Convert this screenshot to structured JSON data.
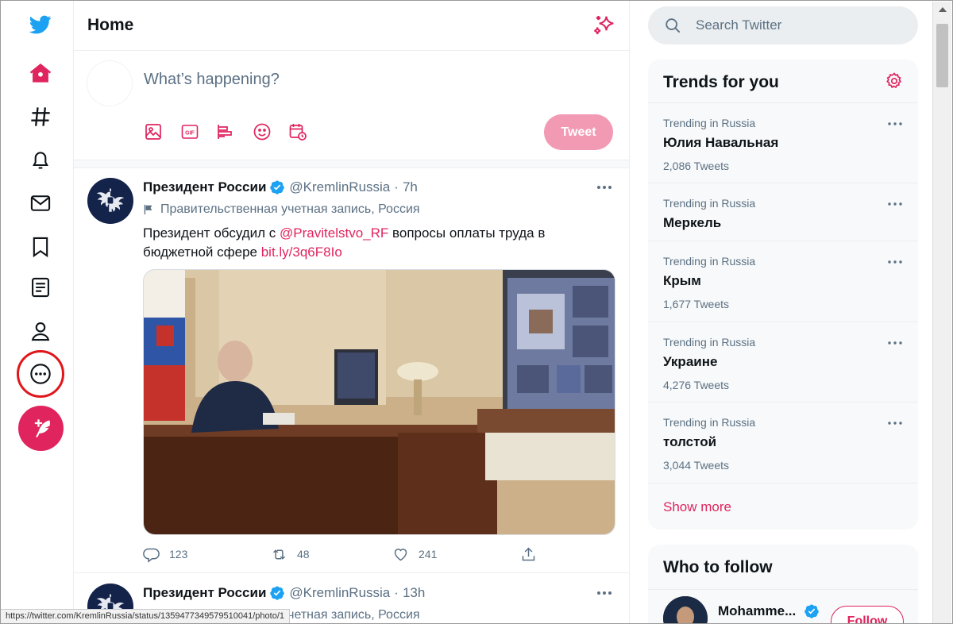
{
  "header": {
    "title": "Home"
  },
  "composer": {
    "placeholder": "What’s happening?",
    "tweet_label": "Tweet"
  },
  "tweets": [
    {
      "name": "Президент России",
      "handle": "@KremlinRussia",
      "dot": "·",
      "time": "7h",
      "gov_label": "Правительственная учетная запись, Россия",
      "text_before": "Президент обсудил с ",
      "mention": "@Pravitelstvo_RF",
      "text_middle": " вопросы оплаты труда в бюджетной сфере ",
      "link": "bit.ly/3q6F8Io",
      "replies": "123",
      "retweets": "48",
      "likes": "241"
    },
    {
      "name": "Президент России",
      "handle": "@KremlinRussia",
      "dot": "·",
      "time": "13h",
      "gov_label": "Правительственная учетная запись, Россия"
    }
  ],
  "search": {
    "placeholder": "Search Twitter"
  },
  "trends": {
    "title": "Trends for you",
    "items": [
      {
        "context": "Trending in Russia",
        "name": "Юлия Навальная",
        "count": "2,086 Tweets"
      },
      {
        "context": "Trending in Russia",
        "name": "Меркель",
        "count": ""
      },
      {
        "context": "Trending in Russia",
        "name": "Крым",
        "count": "1,677 Tweets"
      },
      {
        "context": "Trending in Russia",
        "name": "Украине",
        "count": "4,276 Tweets"
      },
      {
        "context": "Trending in Russia",
        "name": "толстой",
        "count": "3,044 Tweets"
      }
    ],
    "show_more": "Show more"
  },
  "who_to_follow": {
    "title": "Who to follow",
    "name": "Mohamme...",
    "follow_label": "Follow"
  },
  "status_bar": {
    "url": "https://twitter.com/KremlinRussia/status/1359477349579510041/photo/1"
  },
  "colors": {
    "accent": "#e0245e",
    "twitter_blue": "#1da1f2",
    "highlight_ring": "#e0161b"
  }
}
